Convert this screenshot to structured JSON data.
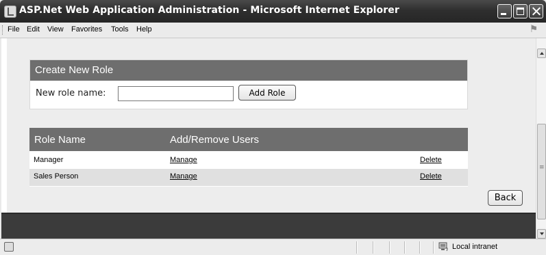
{
  "window": {
    "title": "ASP.Net Web Application Administration - Microsoft Internet Explorer"
  },
  "menu": {
    "items": [
      "File",
      "Edit",
      "View",
      "Favorites",
      "Tools",
      "Help"
    ]
  },
  "create_role": {
    "title": "Create New Role",
    "label": "New role name:",
    "input_value": "",
    "button": "Add Role"
  },
  "roles_table": {
    "headers": [
      "Role Name",
      "Add/Remove Users"
    ],
    "rows": [
      {
        "name": "Manager",
        "manage": "Manage",
        "delete": "Delete"
      },
      {
        "name": "Sales Person",
        "manage": "Manage",
        "delete": "Delete"
      }
    ]
  },
  "back_button": "Back",
  "status": {
    "zone": "Local intranet"
  }
}
